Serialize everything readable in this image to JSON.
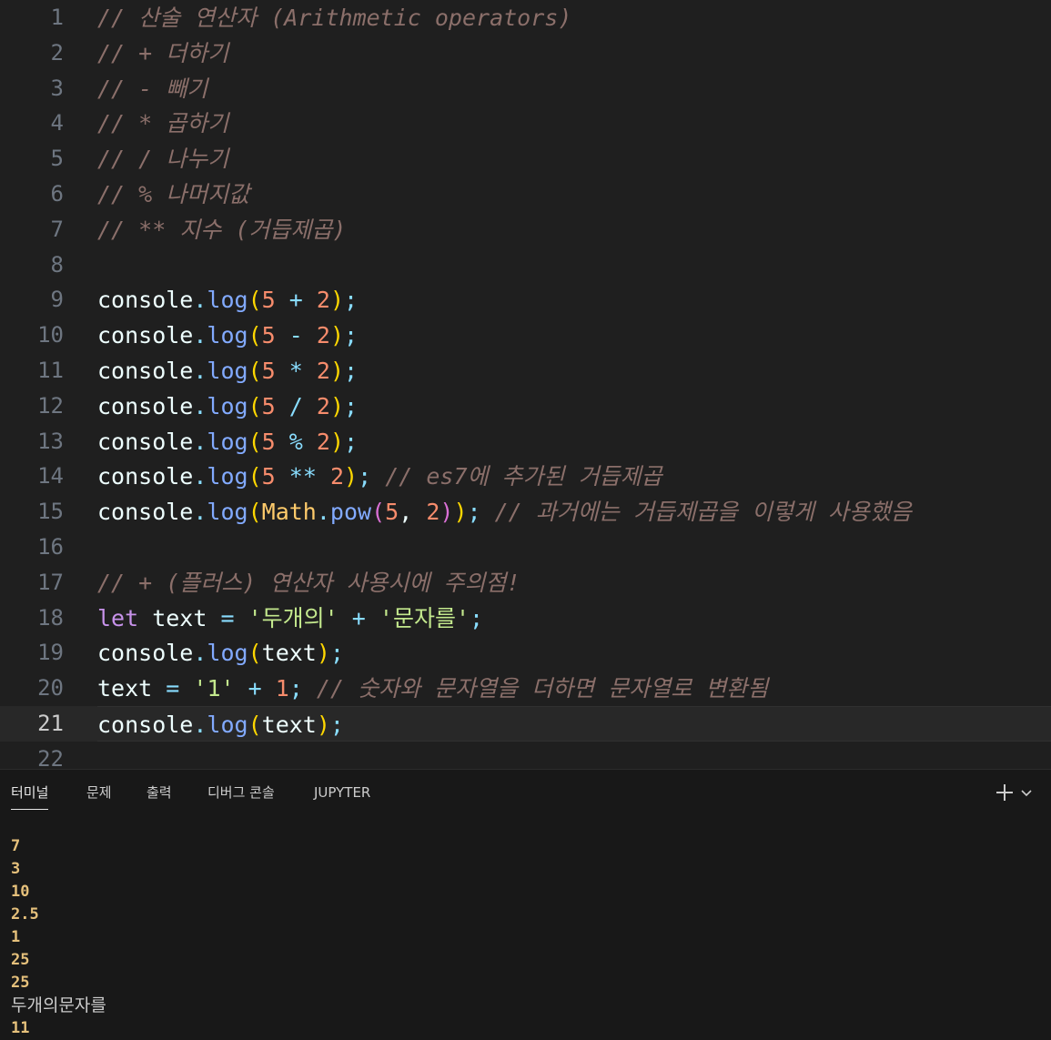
{
  "editor": {
    "lines": [
      {
        "n": "1",
        "tokens": [
          [
            "cm",
            "// 산술 연산자 (Arithmetic operators)"
          ]
        ]
      },
      {
        "n": "2",
        "tokens": [
          [
            "cm",
            "// + 더하기"
          ]
        ]
      },
      {
        "n": "3",
        "tokens": [
          [
            "cm",
            "// - 빼기"
          ]
        ]
      },
      {
        "n": "4",
        "tokens": [
          [
            "cm",
            "// * 곱하기"
          ]
        ]
      },
      {
        "n": "5",
        "tokens": [
          [
            "cm",
            "// / 나누기"
          ]
        ]
      },
      {
        "n": "6",
        "tokens": [
          [
            "cm",
            "// % 나머지값"
          ]
        ]
      },
      {
        "n": "7",
        "tokens": [
          [
            "cm",
            "// ** 지수 (거듭제곱)"
          ]
        ]
      },
      {
        "n": "8",
        "tokens": []
      },
      {
        "n": "9",
        "tokens": [
          [
            "id",
            "console"
          ],
          [
            "dot",
            "."
          ],
          [
            "fn",
            "log"
          ],
          [
            "p1",
            "("
          ],
          [
            "num",
            "5"
          ],
          [
            "id",
            " "
          ],
          [
            "op",
            "+"
          ],
          [
            "id",
            " "
          ],
          [
            "num",
            "2"
          ],
          [
            "p1",
            ")"
          ],
          [
            "semi",
            ";"
          ]
        ]
      },
      {
        "n": "10",
        "tokens": [
          [
            "id",
            "console"
          ],
          [
            "dot",
            "."
          ],
          [
            "fn",
            "log"
          ],
          [
            "p1",
            "("
          ],
          [
            "num",
            "5"
          ],
          [
            "id",
            " "
          ],
          [
            "op",
            "-"
          ],
          [
            "id",
            " "
          ],
          [
            "num",
            "2"
          ],
          [
            "p1",
            ")"
          ],
          [
            "semi",
            ";"
          ]
        ]
      },
      {
        "n": "11",
        "tokens": [
          [
            "id",
            "console"
          ],
          [
            "dot",
            "."
          ],
          [
            "fn",
            "log"
          ],
          [
            "p1",
            "("
          ],
          [
            "num",
            "5"
          ],
          [
            "id",
            " "
          ],
          [
            "op",
            "*"
          ],
          [
            "id",
            " "
          ],
          [
            "num",
            "2"
          ],
          [
            "p1",
            ")"
          ],
          [
            "semi",
            ";"
          ]
        ]
      },
      {
        "n": "12",
        "tokens": [
          [
            "id",
            "console"
          ],
          [
            "dot",
            "."
          ],
          [
            "fn",
            "log"
          ],
          [
            "p1",
            "("
          ],
          [
            "num",
            "5"
          ],
          [
            "id",
            " "
          ],
          [
            "op",
            "/"
          ],
          [
            "id",
            " "
          ],
          [
            "num",
            "2"
          ],
          [
            "p1",
            ")"
          ],
          [
            "semi",
            ";"
          ]
        ]
      },
      {
        "n": "13",
        "tokens": [
          [
            "id",
            "console"
          ],
          [
            "dot",
            "."
          ],
          [
            "fn",
            "log"
          ],
          [
            "p1",
            "("
          ],
          [
            "num",
            "5"
          ],
          [
            "id",
            " "
          ],
          [
            "op",
            "%"
          ],
          [
            "id",
            " "
          ],
          [
            "num",
            "2"
          ],
          [
            "p1",
            ")"
          ],
          [
            "semi",
            ";"
          ]
        ]
      },
      {
        "n": "14",
        "tokens": [
          [
            "id",
            "console"
          ],
          [
            "dot",
            "."
          ],
          [
            "fn",
            "log"
          ],
          [
            "p1",
            "("
          ],
          [
            "num",
            "5"
          ],
          [
            "id",
            " "
          ],
          [
            "op",
            "**"
          ],
          [
            "id",
            " "
          ],
          [
            "num",
            "2"
          ],
          [
            "p1",
            ")"
          ],
          [
            "semi",
            ";"
          ],
          [
            "id",
            " "
          ],
          [
            "cm",
            "// es7에 추가된 거듭제곱"
          ]
        ]
      },
      {
        "n": "15",
        "tokens": [
          [
            "id",
            "console"
          ],
          [
            "dot",
            "."
          ],
          [
            "fn",
            "log"
          ],
          [
            "p1",
            "("
          ],
          [
            "cls",
            "Math"
          ],
          [
            "dot",
            "."
          ],
          [
            "fn",
            "pow"
          ],
          [
            "p2",
            "("
          ],
          [
            "num",
            "5"
          ],
          [
            "id",
            ", "
          ],
          [
            "num",
            "2"
          ],
          [
            "p2",
            ")"
          ],
          [
            "p1",
            ")"
          ],
          [
            "semi",
            ";"
          ],
          [
            "id",
            " "
          ],
          [
            "cm",
            "// 과거에는 거듭제곱을 이렇게 사용했음"
          ]
        ]
      },
      {
        "n": "16",
        "tokens": []
      },
      {
        "n": "17",
        "tokens": [
          [
            "cm",
            "// + (플러스) 연산자 사용시에 주의점!"
          ]
        ]
      },
      {
        "n": "18",
        "tokens": [
          [
            "kw",
            "let"
          ],
          [
            "id",
            " text "
          ],
          [
            "op",
            "="
          ],
          [
            "id",
            " "
          ],
          [
            "str",
            "'두개의'"
          ],
          [
            "id",
            " "
          ],
          [
            "op",
            "+"
          ],
          [
            "id",
            " "
          ],
          [
            "str",
            "'문자를'"
          ],
          [
            "semi",
            ";"
          ]
        ]
      },
      {
        "n": "19",
        "tokens": [
          [
            "id",
            "console"
          ],
          [
            "dot",
            "."
          ],
          [
            "fn",
            "log"
          ],
          [
            "p1",
            "("
          ],
          [
            "id",
            "text"
          ],
          [
            "p1",
            ")"
          ],
          [
            "semi",
            ";"
          ]
        ]
      },
      {
        "n": "20",
        "tokens": [
          [
            "id",
            "text "
          ],
          [
            "op",
            "="
          ],
          [
            "id",
            " "
          ],
          [
            "str",
            "'1'"
          ],
          [
            "id",
            " "
          ],
          [
            "op",
            "+"
          ],
          [
            "id",
            " "
          ],
          [
            "num",
            "1"
          ],
          [
            "semi",
            ";"
          ],
          [
            "id",
            " "
          ],
          [
            "cm",
            "// 숫자와 문자열을 더하면 문자열로 변환됨"
          ]
        ]
      },
      {
        "n": "21",
        "current": true,
        "tokens": [
          [
            "id",
            "console"
          ],
          [
            "dot",
            "."
          ],
          [
            "fn",
            "log"
          ],
          [
            "p1",
            "("
          ],
          [
            "id",
            "text"
          ],
          [
            "p1",
            ")"
          ],
          [
            "semi",
            ";"
          ]
        ]
      },
      {
        "n": "22",
        "tokens": []
      }
    ]
  },
  "panel": {
    "tabs": [
      "터미널",
      "문제",
      "출력",
      "디버그 콘솔",
      "JUPYTER"
    ],
    "active_tab": 0,
    "output": [
      {
        "text": "7"
      },
      {
        "text": "3"
      },
      {
        "text": "10"
      },
      {
        "text": "2.5"
      },
      {
        "text": "1"
      },
      {
        "text": "25"
      },
      {
        "text": "25"
      },
      {
        "text": "두개의문자를",
        "kind": "string"
      },
      {
        "text": "11"
      }
    ]
  },
  "colors": {
    "editor_bg": "#1f1f1f",
    "panel_bg": "#181818",
    "comment": "#8b6f6a",
    "number_output": "#e5c07b"
  }
}
